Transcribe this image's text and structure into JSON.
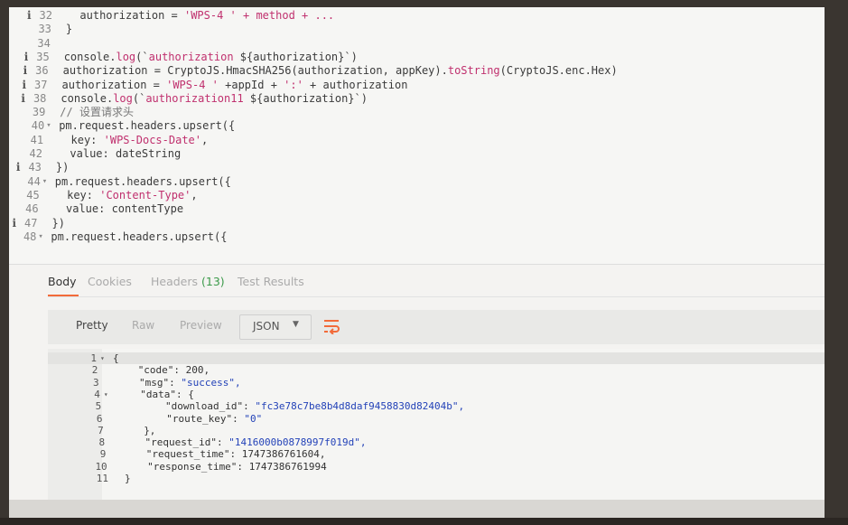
{
  "editor": {
    "lines": [
      {
        "num": "32",
        "info": true,
        "fold": false,
        "indent": 2,
        "segments": [
          {
            "t": "authorization = ",
            "c": ""
          },
          {
            "t": "'WPS-4 ' + method + ...",
            "c": "str"
          }
        ]
      },
      {
        "num": "33",
        "info": false,
        "fold": false,
        "indent": 0,
        "segments": [
          {
            "t": "}",
            "c": ""
          }
        ]
      },
      {
        "num": "34",
        "info": false,
        "fold": false,
        "indent": 0,
        "segments": []
      },
      {
        "num": "35",
        "info": true,
        "fold": false,
        "indent": 0,
        "segments": [
          {
            "t": "console.",
            "c": ""
          },
          {
            "t": "log",
            "c": "fn"
          },
          {
            "t": "(`",
            "c": ""
          },
          {
            "t": "authorization ",
            "c": "str"
          },
          {
            "t": "${authorization}",
            "c": ""
          },
          {
            "t": "`)",
            "c": ""
          }
        ]
      },
      {
        "num": "36",
        "info": true,
        "fold": false,
        "indent": 0,
        "segments": [
          {
            "t": "authorization = CryptoJS.HmacSHA256(authorization, appKey).",
            "c": ""
          },
          {
            "t": "toString",
            "c": "fn"
          },
          {
            "t": "(CryptoJS.enc.Hex)",
            "c": ""
          }
        ]
      },
      {
        "num": "37",
        "info": true,
        "fold": false,
        "indent": 0,
        "segments": [
          {
            "t": "authorization = ",
            "c": ""
          },
          {
            "t": "'WPS-4 '",
            "c": "str"
          },
          {
            "t": " +appId + ",
            "c": ""
          },
          {
            "t": "':'",
            "c": "str"
          },
          {
            "t": " + authorization",
            "c": ""
          }
        ]
      },
      {
        "num": "38",
        "info": true,
        "fold": false,
        "indent": 0,
        "segments": [
          {
            "t": "console.",
            "c": ""
          },
          {
            "t": "log",
            "c": "fn"
          },
          {
            "t": "(`",
            "c": ""
          },
          {
            "t": "authorization11 ",
            "c": "str"
          },
          {
            "t": "${authorization}",
            "c": ""
          },
          {
            "t": "`)",
            "c": ""
          }
        ]
      },
      {
        "num": "39",
        "info": false,
        "fold": false,
        "indent": 0,
        "segments": [
          {
            "t": "// 设置请求头",
            "c": "comment"
          }
        ]
      },
      {
        "num": "40",
        "info": false,
        "fold": true,
        "indent": 0,
        "segments": [
          {
            "t": "pm.request.headers.upsert({",
            "c": ""
          }
        ]
      },
      {
        "num": "41",
        "info": false,
        "fold": false,
        "indent": 2,
        "segments": [
          {
            "t": "key: ",
            "c": ""
          },
          {
            "t": "'WPS-Docs-Date'",
            "c": "str"
          },
          {
            "t": ",",
            "c": ""
          }
        ]
      },
      {
        "num": "42",
        "info": false,
        "fold": false,
        "indent": 2,
        "segments": [
          {
            "t": "value: dateString",
            "c": ""
          }
        ]
      },
      {
        "num": "43",
        "info": true,
        "fold": false,
        "indent": 0,
        "segments": [
          {
            "t": "})",
            "c": ""
          }
        ]
      },
      {
        "num": "44",
        "info": false,
        "fold": true,
        "indent": 0,
        "segments": [
          {
            "t": "pm.request.headers.upsert({",
            "c": ""
          }
        ]
      },
      {
        "num": "45",
        "info": false,
        "fold": false,
        "indent": 2,
        "segments": [
          {
            "t": "key: ",
            "c": ""
          },
          {
            "t": "'Content-Type'",
            "c": "str"
          },
          {
            "t": ",",
            "c": ""
          }
        ]
      },
      {
        "num": "46",
        "info": false,
        "fold": false,
        "indent": 2,
        "segments": [
          {
            "t": "value: contentType",
            "c": ""
          }
        ]
      },
      {
        "num": "47",
        "info": true,
        "fold": false,
        "indent": 0,
        "segments": [
          {
            "t": "})",
            "c": ""
          }
        ]
      },
      {
        "num": "48",
        "info": false,
        "fold": true,
        "indent": 0,
        "segments": [
          {
            "t": "pm.request.headers.upsert({",
            "c": ""
          }
        ]
      }
    ]
  },
  "response": {
    "tabs": [
      {
        "label": "Body",
        "count": "",
        "active": true
      },
      {
        "label": "Cookies",
        "count": "",
        "active": false
      },
      {
        "label": "Headers",
        "count": "(13)",
        "active": false
      },
      {
        "label": "Test Results",
        "count": "",
        "active": false
      }
    ],
    "views": [
      {
        "label": "Pretty",
        "active": true
      },
      {
        "label": "Raw",
        "active": false
      },
      {
        "label": "Preview",
        "active": false
      }
    ],
    "format": "JSON",
    "json_lines": [
      {
        "num": "1",
        "fold": true,
        "indent": 0,
        "key": "",
        "value": "{",
        "type": "punc"
      },
      {
        "num": "2",
        "fold": false,
        "indent": 4,
        "key": "\"code\": ",
        "value": "200,",
        "type": "num"
      },
      {
        "num": "3",
        "fold": false,
        "indent": 4,
        "key": "\"msg\": ",
        "value": "\"success\",",
        "type": "str"
      },
      {
        "num": "4",
        "fold": true,
        "indent": 4,
        "key": "\"data\": ",
        "value": "{",
        "type": "punc"
      },
      {
        "num": "5",
        "fold": false,
        "indent": 8,
        "key": "\"download_id\": ",
        "value": "\"fc3e78c7be8b4d8daf9458830d82404b\",",
        "type": "str"
      },
      {
        "num": "6",
        "fold": false,
        "indent": 8,
        "key": "\"route_key\": ",
        "value": "\"0\"",
        "type": "str"
      },
      {
        "num": "7",
        "fold": false,
        "indent": 4,
        "key": "",
        "value": "},",
        "type": "punc"
      },
      {
        "num": "8",
        "fold": false,
        "indent": 4,
        "key": "\"request_id\": ",
        "value": "\"1416000b0878997f019d\",",
        "type": "str"
      },
      {
        "num": "9",
        "fold": false,
        "indent": 4,
        "key": "\"request_time\": ",
        "value": "1747386761604,",
        "type": "num"
      },
      {
        "num": "10",
        "fold": false,
        "indent": 4,
        "key": "\"response_time\": ",
        "value": "1747386761994",
        "type": "num"
      },
      {
        "num": "11",
        "fold": false,
        "indent": 0,
        "key": "",
        "value": "}",
        "type": "punc"
      }
    ]
  },
  "colors": {
    "accent": "#f26b3a",
    "string": "#c0306e",
    "json_string": "#2342b8",
    "count": "#3b9a4a"
  }
}
